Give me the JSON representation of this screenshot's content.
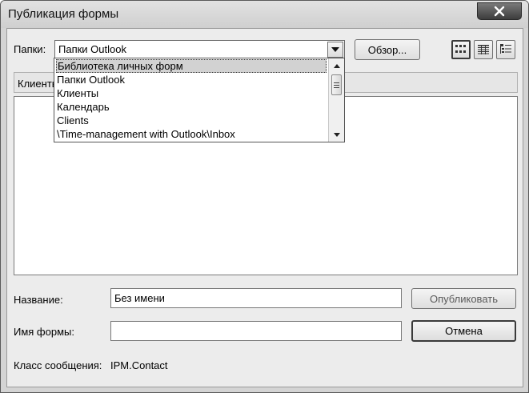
{
  "window": {
    "title": "Публикация формы"
  },
  "folders": {
    "label": "Папки:",
    "value": "Папки Outlook",
    "browse_button": "Обзор...",
    "dropdown_items": [
      "Библиотека личных форм",
      "Папки Outlook",
      "Клиенты",
      "Календарь",
      "Clients",
      "\\Time-management with Outlook\\Inbox"
    ]
  },
  "list": {
    "header": "Клиенты"
  },
  "name_field": {
    "label": "Название:",
    "value": "Без имени"
  },
  "form_name_field": {
    "label": "Имя формы:",
    "value": ""
  },
  "message_class": {
    "label": "Класс сообщения:",
    "value": "IPM.Contact"
  },
  "buttons": {
    "publish": "Опубликовать",
    "cancel": "Отмена"
  }
}
